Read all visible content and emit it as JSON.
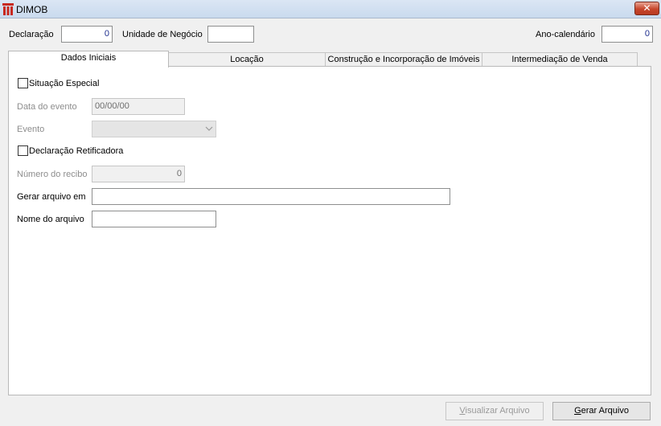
{
  "window": {
    "title": "DIMOB",
    "close_glyph": "✕"
  },
  "header": {
    "declaracao_label": "Declaração",
    "declaracao_value": "0",
    "unidade_label": "Unidade de Negócio",
    "unidade_value": "",
    "ano_label": "Ano-calendário",
    "ano_value": "0"
  },
  "tabs": [
    {
      "label": "Dados Iniciais",
      "active": true
    },
    {
      "label": "Locação",
      "active": false
    },
    {
      "label": "Construção e Incorporação de Imóveis",
      "active": false
    },
    {
      "label": "Intermediação de Venda",
      "active": false
    }
  ],
  "form": {
    "situacao_especial_label": "Situação Especial",
    "situacao_especial_checked": false,
    "data_evento_label": "Data do evento",
    "data_evento_value": "00/00/00",
    "evento_label": "Evento",
    "evento_value": "",
    "retificadora_label": "Declaração Retificadora",
    "retificadora_checked": false,
    "numero_recibo_label": "Número do recibo",
    "numero_recibo_value": "0",
    "gerar_arquivo_em_label": "Gerar arquivo em",
    "gerar_arquivo_em_value": "",
    "nome_arquivo_label": "Nome do arquivo",
    "nome_arquivo_value": ""
  },
  "buttons": {
    "visualizar_first": "V",
    "visualizar_rest": "isualizar Arquivo",
    "gerar_first": "G",
    "gerar_rest": "erar Arquivo"
  },
  "icons": {
    "app": "dimob-app-icon",
    "combo": "chevron-down-icon"
  },
  "colors": {
    "numeric_text": "#1e2e8e",
    "close_button": "#c7462c",
    "titlebar": "#d3e0f1"
  }
}
